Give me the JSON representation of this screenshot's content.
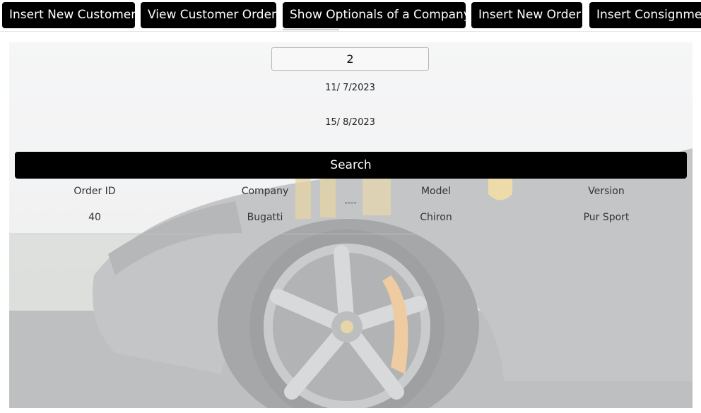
{
  "nav": {
    "items": [
      {
        "label": "Insert New Customer"
      },
      {
        "label": "View Customer Order"
      },
      {
        "label": "Show Optionals of a Company"
      },
      {
        "label": "Insert New Order"
      },
      {
        "label": "Insert Consignmen"
      }
    ]
  },
  "form": {
    "customer_id_value": "2",
    "start_date": "11/  7/2023",
    "end_date": "15/  8/2023",
    "search_label": "Search"
  },
  "results": {
    "headers": [
      "Order ID",
      "Company",
      "Model",
      "Version"
    ],
    "separator": "----",
    "rows": [
      [
        "40",
        "Bugatti",
        "Chiron",
        "Pur Sport"
      ]
    ]
  }
}
